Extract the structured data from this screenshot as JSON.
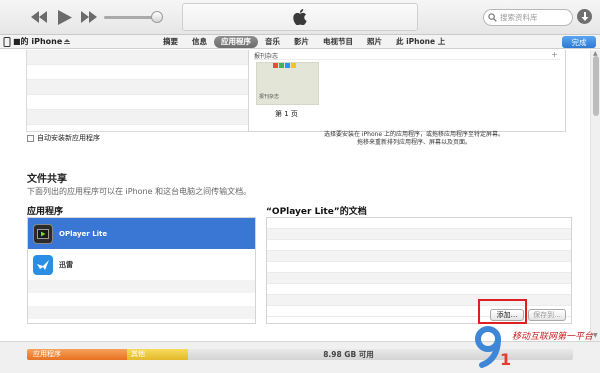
{
  "toolbar": {
    "search_placeholder": "搜索资料库"
  },
  "nav": {
    "device_name": "■的 iPhone",
    "tabs": [
      {
        "label": "摘要"
      },
      {
        "label": "信息"
      },
      {
        "label": "应用程序",
        "active": true
      },
      {
        "label": "音乐"
      },
      {
        "label": "影片"
      },
      {
        "label": "电视节目"
      },
      {
        "label": "照片"
      },
      {
        "label": "此 iPhone 上"
      }
    ],
    "done_label": "完成"
  },
  "homescreen": {
    "title": "报刊杂志",
    "thumb_label": "报刊杂志",
    "page_label": "第 1 页"
  },
  "auto_install_label": "自动安装新应用程序",
  "hint": {
    "line1": "选择要安装在 iPhone 上的应用程序，或拖移应用程序至特定屏幕。",
    "line2": "拖移来重新排列应用程序、屏幕以及页面。"
  },
  "file_sharing": {
    "title": "文件共享",
    "description": "下面列出的应用程序可以在 iPhone 和这台电脑之间传输文档。",
    "apps_header": "应用程序",
    "docs_header": "“OPlayer Lite”的文档",
    "apps": [
      {
        "name": "OPlayer Lite",
        "selected": true
      },
      {
        "name": "迅雷",
        "selected": false
      }
    ],
    "add_label": "添加...",
    "save_label": "保存到..."
  },
  "capacity": {
    "apps_label": "应用程序",
    "other_label": "其他",
    "free_label": "8.98 GB 可用"
  },
  "watermark": {
    "text": "移动互联网第一平台"
  },
  "colors": {
    "accent": "#3a77d4",
    "highlight": "#e02020",
    "apps_segment": "#e8711f",
    "other_segment": "#e4b82a"
  }
}
